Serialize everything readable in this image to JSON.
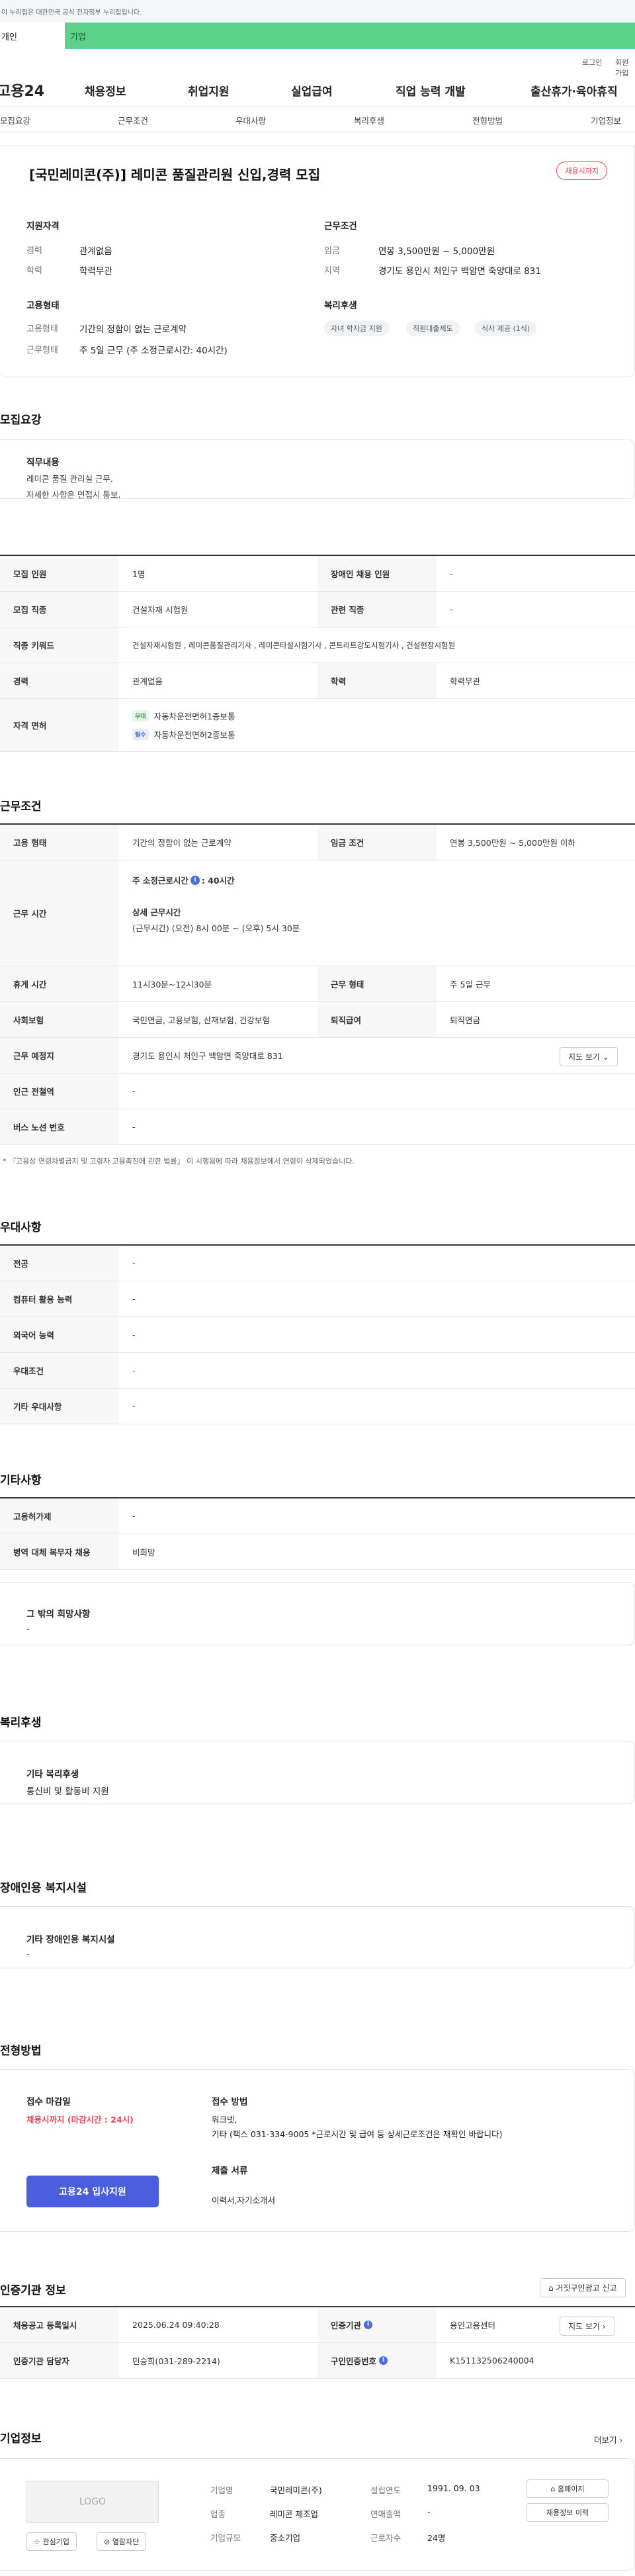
{
  "notice": "이 누리집은 대한민국 공식 전자정부 누리집입니다.",
  "usertabs": {
    "personal": "개인",
    "company": "기업"
  },
  "util": {
    "login": "로그인",
    "join": "회원가입"
  },
  "logo": "고용24",
  "gnb": [
    "채용정보",
    "취업지원",
    "실업급여",
    "직업 능력 개발",
    "출산휴가·육아휴직"
  ],
  "subtabs": [
    "모집요강",
    "근무조건",
    "우대사항",
    "복리후생",
    "전형방법",
    "기업정보"
  ],
  "job": {
    "title": "[국민레미콘(주)] 레미콘 품질관리원 신입,경력 모집",
    "status": "채용시까지",
    "qual_head": "지원자격",
    "career_label": "경력",
    "career": "관계없음",
    "edu_label": "학력",
    "edu": "학력무관",
    "cond_head": "근무조건",
    "wage_label": "임금",
    "wage": "연봉 3,500만원 ~ 5,000만원",
    "region_label": "지역",
    "region": "경기도 용인시 처인구 백암면 죽양대로 831",
    "emp_head": "고용형태",
    "emp_label": "고용형태",
    "emp": "기간의 정함이 없는 근로계약",
    "work_label": "근무형태",
    "work": "주 5일 근무 (주 소정근로시간: 40시간)",
    "welfare_head": "복리후생",
    "chips": [
      "자녀 학자금 지원",
      "직원대출제도",
      "식사 제공 (1식)"
    ]
  },
  "recruit": {
    "title": "모집요강",
    "duty_head": "직무내용",
    "duty1": "레미콘 품질 관리실 근무.",
    "duty2": "자세한 사항은 면접시 통보.",
    "rows": {
      "count_l": "모집 인원",
      "count": "1명",
      "disabled_l": "장애인 채용 인원",
      "disabled": "-",
      "job_l": "모집 직종",
      "job": "건설자재 시험원",
      "related_l": "관련 직종",
      "related": "-",
      "kw_l": "직종 키워드",
      "kw": "건설자재시험원 , 레미콘품질관리기사 , 레미콘타설시험기사 , 콘트리트강도시험기사 , 건설현장시험원",
      "career_l": "경력",
      "career": "관계없음",
      "edu_l": "학력",
      "edu": "학력무관",
      "license_l": "자격 면허",
      "tag1": "우대",
      "lic1": "자동차운전면허1종보통",
      "tag2": "필수",
      "lic2": "자동차운전면허2종보통"
    }
  },
  "workcond": {
    "title": "근무조건",
    "emp_l": "고용 형태",
    "emp": "기간의 정함이 없는 근로계약",
    "wage_l": "임금 조건",
    "wage": "연봉 3,500만원 ~ 5,000만원 이하",
    "hours_l": "근무 시간",
    "hours_main": "주 소정근로시간 ",
    "hours_val": ": 40시간",
    "detail_head": "상세 근무시간",
    "detail": "(근무시간) (오전) 8시 00분 ~ (오후) 5시 30분",
    "break_l": "휴게 시간",
    "break": "11시30분~12시30분",
    "form_l": "근무 형태",
    "form": "주 5일 근무",
    "ins_l": "사회보험",
    "ins": "국민연금, 고용보험, 산재보험, 건강보험",
    "retire_l": "퇴직급여",
    "retire": "퇴직연금",
    "place_l": "근무 예정지",
    "place": "경기도 용인시 처인구 백암면 죽양대로 831",
    "map_btn": "지도 보기 ⌄",
    "station_l": "인근 전철역",
    "station": "-",
    "bus_l": "버스 노선 번호",
    "bus": "-",
    "footnote": "* 『고용상 연령차별금지 및 고령자 고용촉진에 관한 법률』 이 시행됨에 따라 채용정보에서 연령이 삭제되었습니다."
  },
  "pref": {
    "title": "우대사항",
    "rows": [
      {
        "l": "전공",
        "v": "-"
      },
      {
        "l": "컴퓨터 활용 능력",
        "v": "-"
      },
      {
        "l": "외국어 능력",
        "v": "-"
      },
      {
        "l": "우대조건",
        "v": "-"
      },
      {
        "l": "기타 우대사항",
        "v": "-"
      }
    ]
  },
  "etc": {
    "title": "기타사항",
    "hire_l": "고용허가제",
    "hire": "-",
    "mil_l": "병역 대체 복무자 채용",
    "mil": "비희망",
    "other_head": "그 밖의 희망사항",
    "other": "-"
  },
  "welfare": {
    "title": "복리후생",
    "head": "기타 복리후생",
    "val": "통신비 및 활동비 지원"
  },
  "disab": {
    "title": "장애인용 복지시설",
    "head": "기타 장애인용 복지시설",
    "val": "-"
  },
  "method": {
    "title": "전형방법",
    "deadline_head": "접수 마감일",
    "deadline": "채용시까지 (마감시간 : 24시)",
    "how_head": "접수 방법",
    "how1": "워크넷,",
    "how2": "기타 (팩스 031-334-9005 *근로시간 및 급여 등 상세근로조건은 재확인 바랍니다)",
    "docs_head": "제출 서류",
    "docs": "이력서,자기소개서",
    "apply_btn": "고용24 입사지원"
  },
  "agency": {
    "title": "인증기관 정보",
    "report_btn": "거짓구인광고 신고",
    "reg_l": "채용공고 등록일시",
    "reg": "2025.06.24 09:40:28",
    "org_l": "인증기관",
    "org": "용인고용센터",
    "map_btn": "지도 보기 ›",
    "mgr_l": "인증기관 담당자",
    "mgr": "민승희(031-289-2214)",
    "no_l": "구인인증번호",
    "no": "K151132506240004"
  },
  "company": {
    "title": "기업정보",
    "more": "더보기 ›",
    "logo": "LOGO",
    "name_l": "기업명",
    "name": "국민레미콘(주)",
    "year_l": "설립연도",
    "year": "1991. 09. 03",
    "ind_l": "업종",
    "ind": "레미콘 제조업",
    "sales_l": "연매출액",
    "sales": "-",
    "size_l": "기업규모",
    "size": "중소기업",
    "emp_l": "근로자수",
    "emp": "24명",
    "home_btn": "홈페이지",
    "hist_btn": "채용정보 이력",
    "fav_btn": "관심기업",
    "block_btn": "열람차단"
  }
}
